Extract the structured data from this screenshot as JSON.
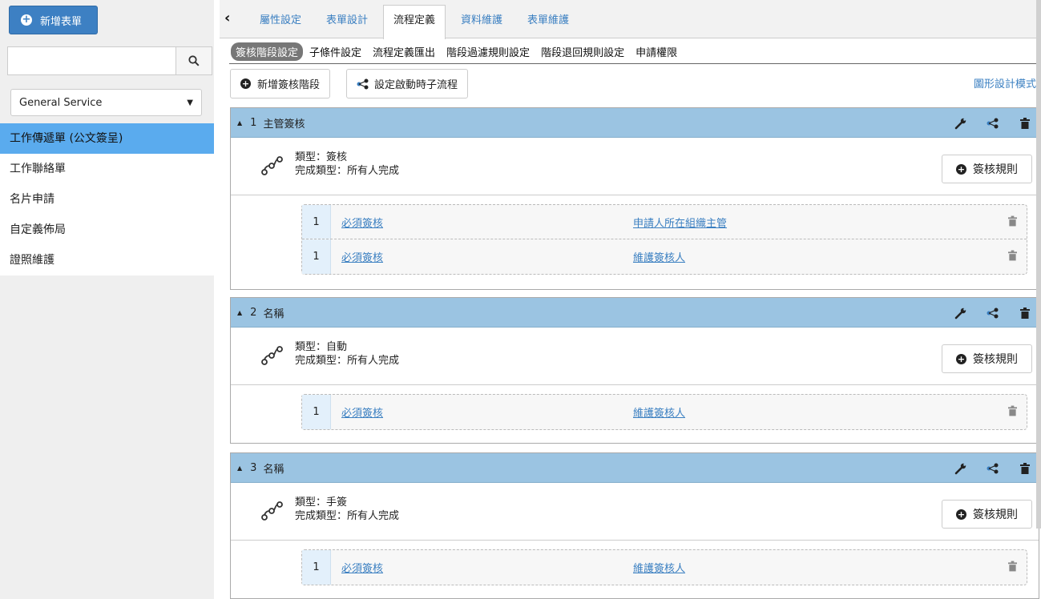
{
  "sidebar": {
    "new_form_label": "新增表單",
    "search_placeholder": "",
    "select_value": "General Service",
    "items": [
      {
        "label": "工作傳遞單 (公文簽呈)"
      },
      {
        "label": "工作聯絡單"
      },
      {
        "label": "名片申請"
      },
      {
        "label": "自定義佈局"
      },
      {
        "label": "證照維護"
      }
    ]
  },
  "tabs": [
    {
      "label": "屬性設定"
    },
    {
      "label": "表單設計"
    },
    {
      "label": "流程定義"
    },
    {
      "label": "資料維護"
    },
    {
      "label": "表單維護"
    }
  ],
  "subtabs": [
    {
      "label": "簽核階段設定"
    },
    {
      "label": "子條件設定"
    },
    {
      "label": "流程定義匯出"
    },
    {
      "label": "階段過濾規則設定"
    },
    {
      "label": "階段退回規則設定"
    },
    {
      "label": "申請權限"
    }
  ],
  "actions": {
    "add_stage": "新增簽核階段",
    "set_subflow": "設定啟動時子流程",
    "graphic_mode": "圖形設計模式"
  },
  "stages": [
    {
      "num": "1",
      "name": "主管簽核",
      "type_line": "類型：簽核",
      "done_line": "完成類型：所有人完成",
      "rule_label": "簽核規則",
      "rows": [
        {
          "idx": "1",
          "c1": "必須簽核",
          "c2": "申請人所在組織主管"
        },
        {
          "idx": "1",
          "c1": "必須簽核",
          "c2": "維護簽核人"
        }
      ]
    },
    {
      "num": "2",
      "name": "名稱",
      "type_line": "類型：自動",
      "done_line": "完成類型：所有人完成",
      "rule_label": "簽核規則",
      "rows": [
        {
          "idx": "1",
          "c1": "必須簽核",
          "c2": "維護簽核人"
        }
      ]
    },
    {
      "num": "3",
      "name": "名稱",
      "type_line": "類型：手簽",
      "done_line": "完成類型：所有人完成",
      "rule_label": "簽核規則",
      "rows": [
        {
          "idx": "1",
          "c1": "必須簽核",
          "c2": "維護簽核人"
        }
      ]
    }
  ],
  "colors": {
    "primary": "#3d80c3",
    "active_nav": "#5aabee",
    "stage_header": "#9bc4e2",
    "link": "#3a7fc1"
  }
}
